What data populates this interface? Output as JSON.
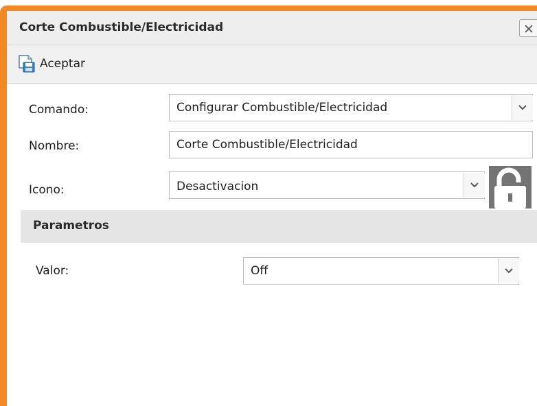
{
  "dialog": {
    "title": "Corte Combustible/Electricidad",
    "close_icon": "close-icon"
  },
  "toolbar": {
    "accept_label": "Aceptar",
    "accept_icon": "save-icon"
  },
  "form": {
    "comando": {
      "label": "Comando:",
      "value": "Configurar Combustible/Electricidad"
    },
    "nombre": {
      "label": "Nombre:",
      "value": "Corte Combustible/Electricidad"
    },
    "icono": {
      "label": "Icono:",
      "value": "Desactivacion",
      "preview_icon": "unlocked-padlock-icon"
    }
  },
  "parametros": {
    "title": "Parametros",
    "valor": {
      "label": "Valor:",
      "value": "Off"
    }
  },
  "colors": {
    "frame_accent": "#f08a24",
    "header_bg": "#eeeeee",
    "section_bg": "#e5e5e5",
    "lock_bg": "#737373"
  }
}
